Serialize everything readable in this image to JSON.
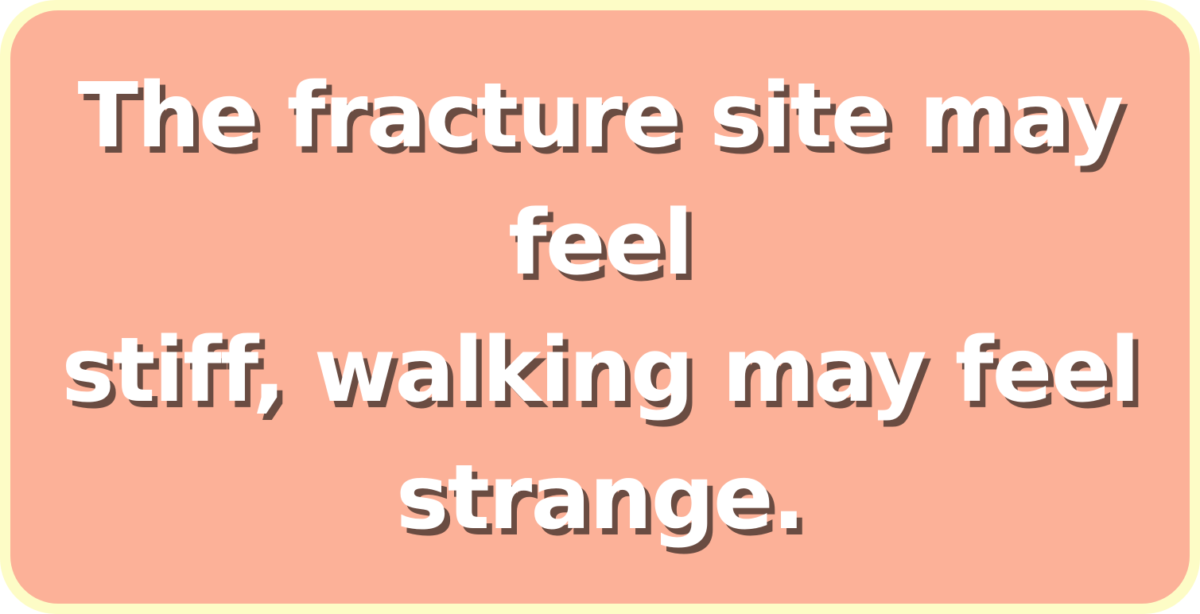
{
  "card": {
    "lines": [
      "The fracture site may feel",
      "stiff, walking may feel",
      "strange."
    ]
  },
  "colors": {
    "outer_frame": "#fdfcc6",
    "card_background": "#fcb198",
    "text": "#ffffff",
    "text_shadow": "#6a4c42"
  }
}
